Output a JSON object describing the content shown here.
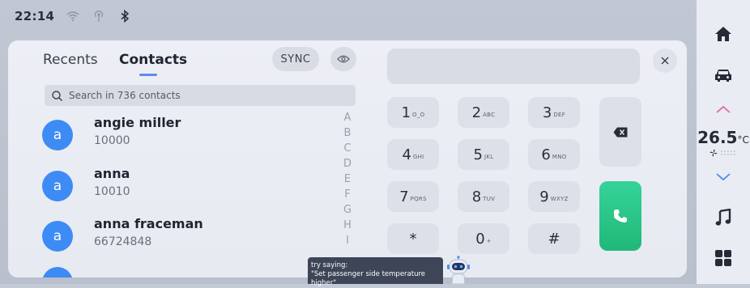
{
  "status_bar": {
    "time": "22:14",
    "icons": [
      "wifi-icon",
      "hotspot-icon",
      "bluetooth-icon"
    ]
  },
  "rail": {
    "items": [
      "home-icon",
      "car-icon",
      "chevron-up-icon",
      "chevron-down-icon",
      "music-icon",
      "apps-grid-icon"
    ],
    "temperature": "26.5",
    "temperature_unit": "°C"
  },
  "tabs": [
    {
      "label": "Recents",
      "active": false
    },
    {
      "label": "Contacts",
      "active": true
    }
  ],
  "sync_label": "SYNC",
  "search": {
    "placeholder": "Search in 736 contacts"
  },
  "contacts": [
    {
      "initial": "a",
      "name": "angie miller",
      "number": "10000"
    },
    {
      "initial": "a",
      "name": "anna",
      "number": "10010"
    },
    {
      "initial": "a",
      "name": "anna fraceman",
      "number": "66724848"
    }
  ],
  "alphabet": [
    "A",
    "B",
    "C",
    "D",
    "E",
    "F",
    "G",
    "H",
    "I"
  ],
  "keypad": [
    {
      "digit": "1",
      "sub": "O_O"
    },
    {
      "digit": "2",
      "sub": "ABC"
    },
    {
      "digit": "3",
      "sub": "DEF"
    },
    {
      "digit": "4",
      "sub": "GHI"
    },
    {
      "digit": "5",
      "sub": "JKL"
    },
    {
      "digit": "6",
      "sub": "MNO"
    },
    {
      "digit": "7",
      "sub": "PQRS"
    },
    {
      "digit": "8",
      "sub": "TUV"
    },
    {
      "digit": "9",
      "sub": "WXYZ"
    },
    {
      "digit": "*",
      "sub": ""
    },
    {
      "digit": "0",
      "sub": "+"
    },
    {
      "digit": "#",
      "sub": ""
    }
  ],
  "voice_hint": {
    "line1": "try saying:",
    "line2": "\"Set passenger side temperature higher\""
  },
  "colors": {
    "accent": "#3d8bf5",
    "call": "#27c383",
    "tab_indicator": "#5d8bf0"
  }
}
